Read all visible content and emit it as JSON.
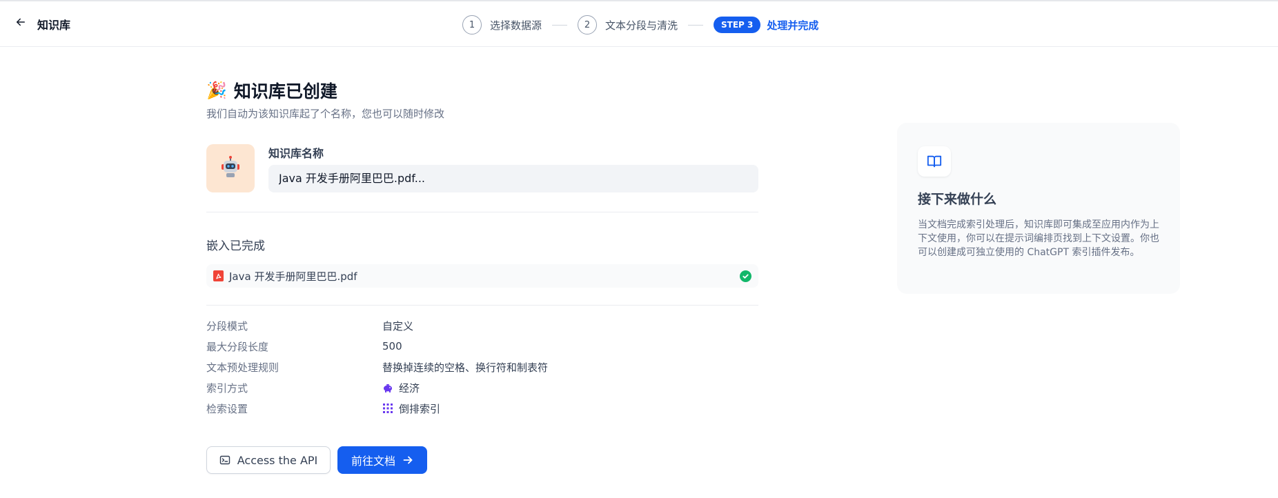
{
  "header": {
    "title": "知识库",
    "steps": [
      {
        "num": "1",
        "label": "选择数据源"
      },
      {
        "num": "2",
        "label": "文本分段与清洗"
      },
      {
        "pill": "STEP 3",
        "label": "处理并完成"
      }
    ]
  },
  "main": {
    "title_emoji": "🎉",
    "title": "知识库已创建",
    "subtitle": "我们自动为该知识库起了个名称，您也可以随时修改",
    "name_label": "知识库名称",
    "name_value": "Java 开发手册阿里巴巴.pdf...",
    "embed_title": "嵌入已完成",
    "file_name": "Java 开发手册阿里巴巴.pdf",
    "file_status": "completed",
    "meta": [
      {
        "key": "分段模式",
        "value": "自定义"
      },
      {
        "key": "最大分段长度",
        "value": "500"
      },
      {
        "key": "文本预处理规则",
        "value": "替换掉连续的空格、换行符和制表符"
      },
      {
        "key": "索引方式",
        "value": "经济",
        "icon": "piggy-bank-icon"
      },
      {
        "key": "检索设置",
        "value": "倒排索引",
        "icon": "grid-dots-icon"
      }
    ],
    "api_button": "Access the API",
    "go_button": "前往文档"
  },
  "side_card": {
    "icon": "book-open-icon",
    "title": "接下来做什么",
    "text": "当文档完成索引处理后，知识库即可集成至应用内作为上下文使用，你可以在提示词编排页找到上下文设置。你也可以创建成可独立使用的 ChatGPT 索引插件发布。"
  },
  "colors": {
    "accent": "#155eef",
    "success": "#12b76a",
    "pdf": "#f04438",
    "avatar_bg": "#fde6d2",
    "index_icon": "#6938ef"
  }
}
